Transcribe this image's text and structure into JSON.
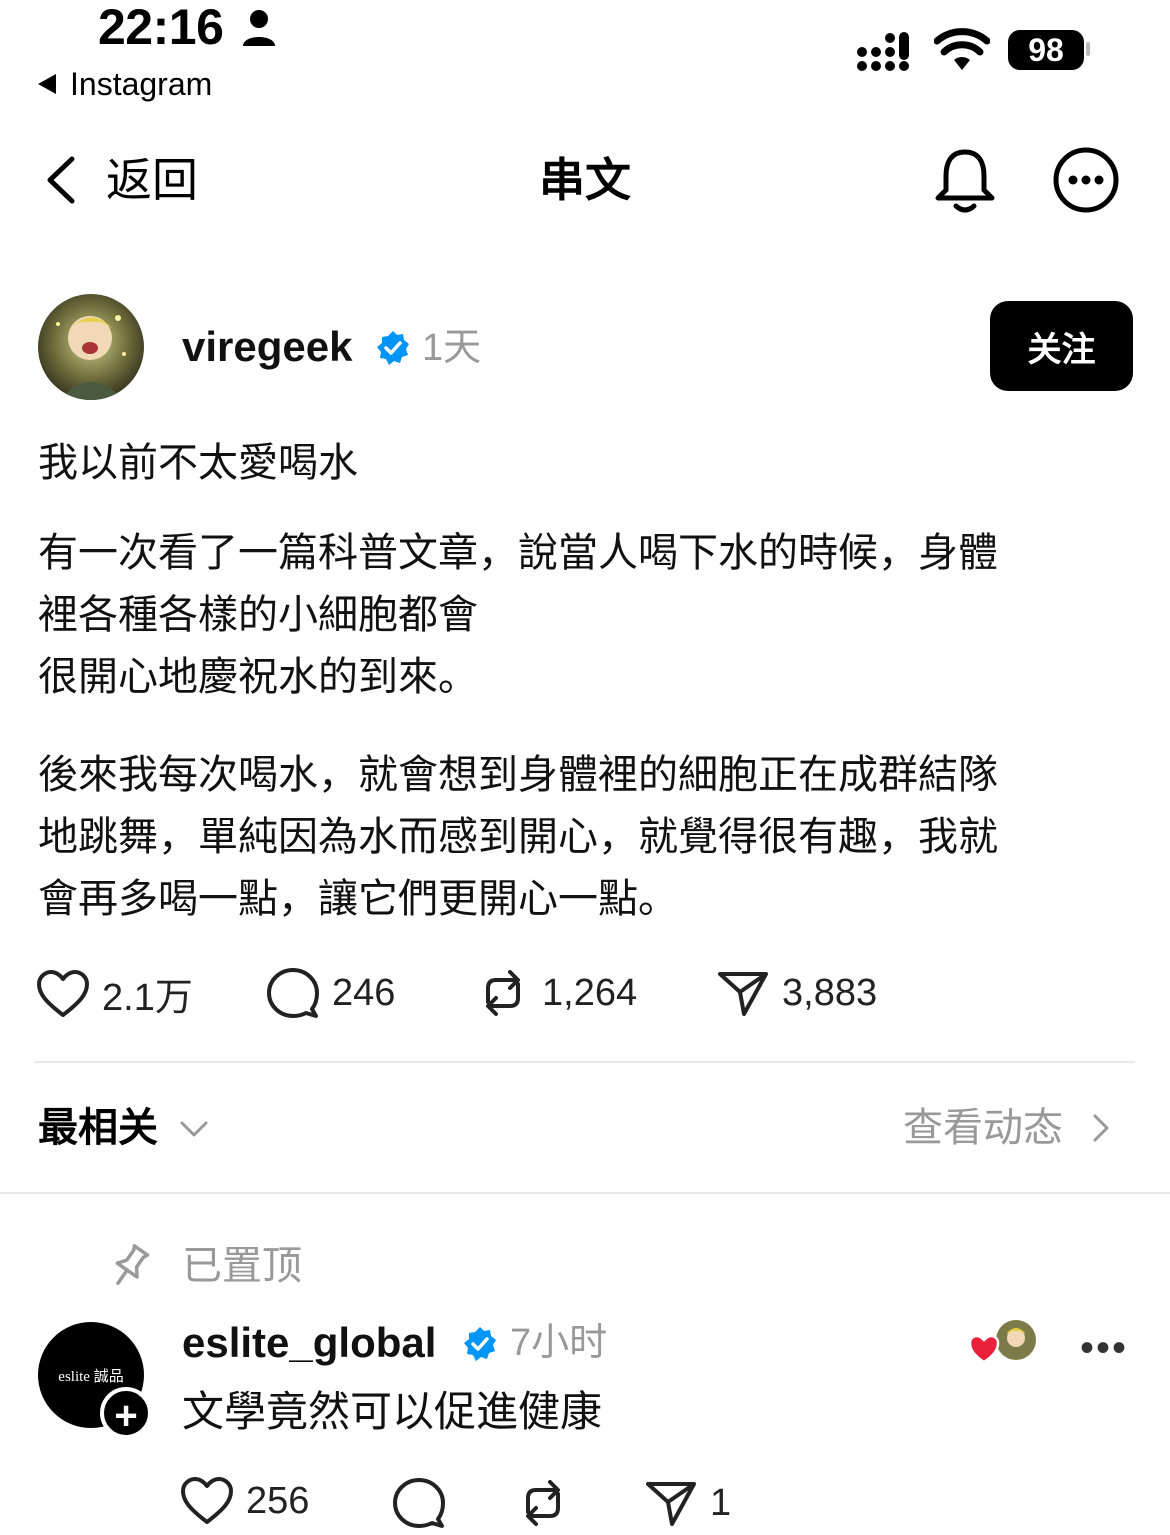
{
  "status_bar": {
    "time": "22:16",
    "back_app": "Instagram",
    "battery": "98"
  },
  "header": {
    "back_label": "返回",
    "title": "串文"
  },
  "post": {
    "username": "viregeek",
    "time": "1天",
    "follow_label": "关注",
    "paragraphs": [
      [
        "我以前不太愛喝水"
      ],
      [
        "有一次看了一篇科普文章，說當人喝下水的時候，身體",
        "裡各種各樣的小細胞都會",
        "很開心地慶祝水的到來。"
      ],
      [
        "後來我每次喝水，就會想到身體裡的細胞正在成群結隊",
        "地跳舞，單純因為水而感到開心，就覺得很有趣，我就",
        "會再多喝一點，讓它們更開心一點。"
      ]
    ],
    "stats": {
      "likes": "2.1万",
      "comments": "246",
      "reposts": "1,264",
      "shares": "3,883"
    }
  },
  "sort": {
    "label": "最相关",
    "activity_label": "查看动态"
  },
  "comment": {
    "pinned_label": "已置顶",
    "username": "eslite_global",
    "avatar_text": "eslite 誠品",
    "time": "7小时",
    "text": "文學竟然可以促進健康",
    "stats": {
      "likes": "256",
      "shares": "1"
    }
  },
  "colors": {
    "verified": "#0095f6",
    "muted": "#999999",
    "like_heart": "#e8203a"
  }
}
